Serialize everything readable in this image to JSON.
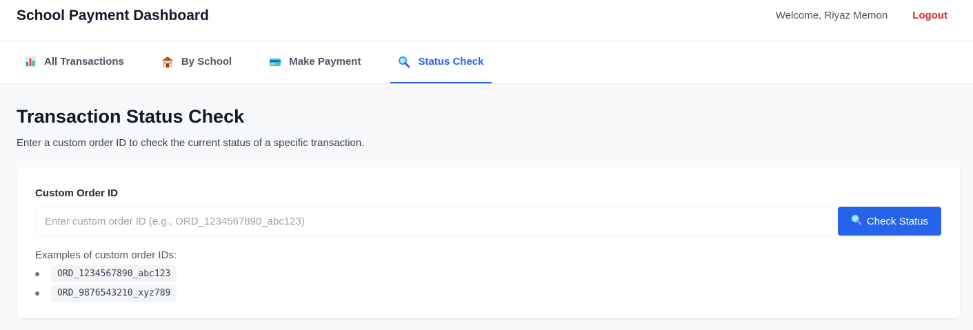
{
  "header": {
    "title": "School Payment Dashboard",
    "welcome": "Welcome, Riyaz Memon",
    "logout_label": "Logout"
  },
  "tabs": [
    {
      "label": "All Transactions",
      "icon": "bar-chart-icon",
      "active": false
    },
    {
      "label": "By School",
      "icon": "school-icon",
      "active": false
    },
    {
      "label": "Make Payment",
      "icon": "credit-card-icon",
      "active": false
    },
    {
      "label": "Status Check",
      "icon": "magnifier-icon",
      "active": true
    }
  ],
  "main": {
    "title": "Transaction Status Check",
    "description": "Enter a custom order ID to check the current status of a specific transaction.",
    "form": {
      "label": "Custom Order ID",
      "value": "",
      "placeholder": "Enter custom order ID (e.g., ORD_1234567890_abc123)",
      "button_label": "Check Status"
    },
    "examples": {
      "title": "Examples of custom order IDs:",
      "items": [
        "ORD_1234567890_abc123",
        "ORD_9876543210_xyz789"
      ]
    }
  },
  "colors": {
    "accent": "#2563eb",
    "logout": "#dc2626"
  }
}
